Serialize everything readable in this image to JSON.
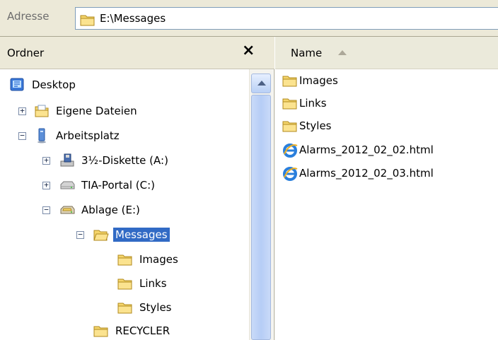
{
  "address": {
    "label": "Adresse",
    "path": "E:\\Messages"
  },
  "folders_pane": {
    "title": "Ordner",
    "close_glyph": "×",
    "tree": [
      {
        "label": "Desktop",
        "icon": "desktop-icon",
        "expander": ""
      },
      {
        "label": "Eigene Dateien",
        "icon": "documents-folder-icon",
        "expander": "+"
      },
      {
        "label": "Arbeitsplatz",
        "icon": "computer-icon",
        "expander": "−"
      },
      {
        "label": "3½-Diskette (A:)",
        "icon": "floppy-drive-icon",
        "expander": "+"
      },
      {
        "label": "TIA-Portal (C:)",
        "icon": "hard-drive-icon",
        "expander": "+"
      },
      {
        "label": "Ablage (E:)",
        "icon": "removable-drive-icon",
        "expander": "−"
      },
      {
        "label": "Messages",
        "icon": "open-folder-icon",
        "expander": "−",
        "selected": true
      },
      {
        "label": "Images",
        "icon": "folder-icon",
        "expander": ""
      },
      {
        "label": "Links",
        "icon": "folder-icon",
        "expander": ""
      },
      {
        "label": "Styles",
        "icon": "folder-icon",
        "expander": ""
      },
      {
        "label": "RECYCLER",
        "icon": "folder-icon",
        "expander": ""
      }
    ]
  },
  "file_list": {
    "column_name": "Name",
    "sort": "ascending",
    "items": [
      {
        "name": "Images",
        "icon": "folder-icon"
      },
      {
        "name": "Links",
        "icon": "folder-icon"
      },
      {
        "name": "Styles",
        "icon": "folder-icon"
      },
      {
        "name": "Alarms_2012_02_02.html",
        "icon": "ie-html-icon"
      },
      {
        "name": "Alarms_2012_02_03.html",
        "icon": "ie-html-icon"
      }
    ]
  },
  "colors": {
    "selection": "#316ac5",
    "chrome": "#ece9d8",
    "folder": "#f5d56c"
  }
}
